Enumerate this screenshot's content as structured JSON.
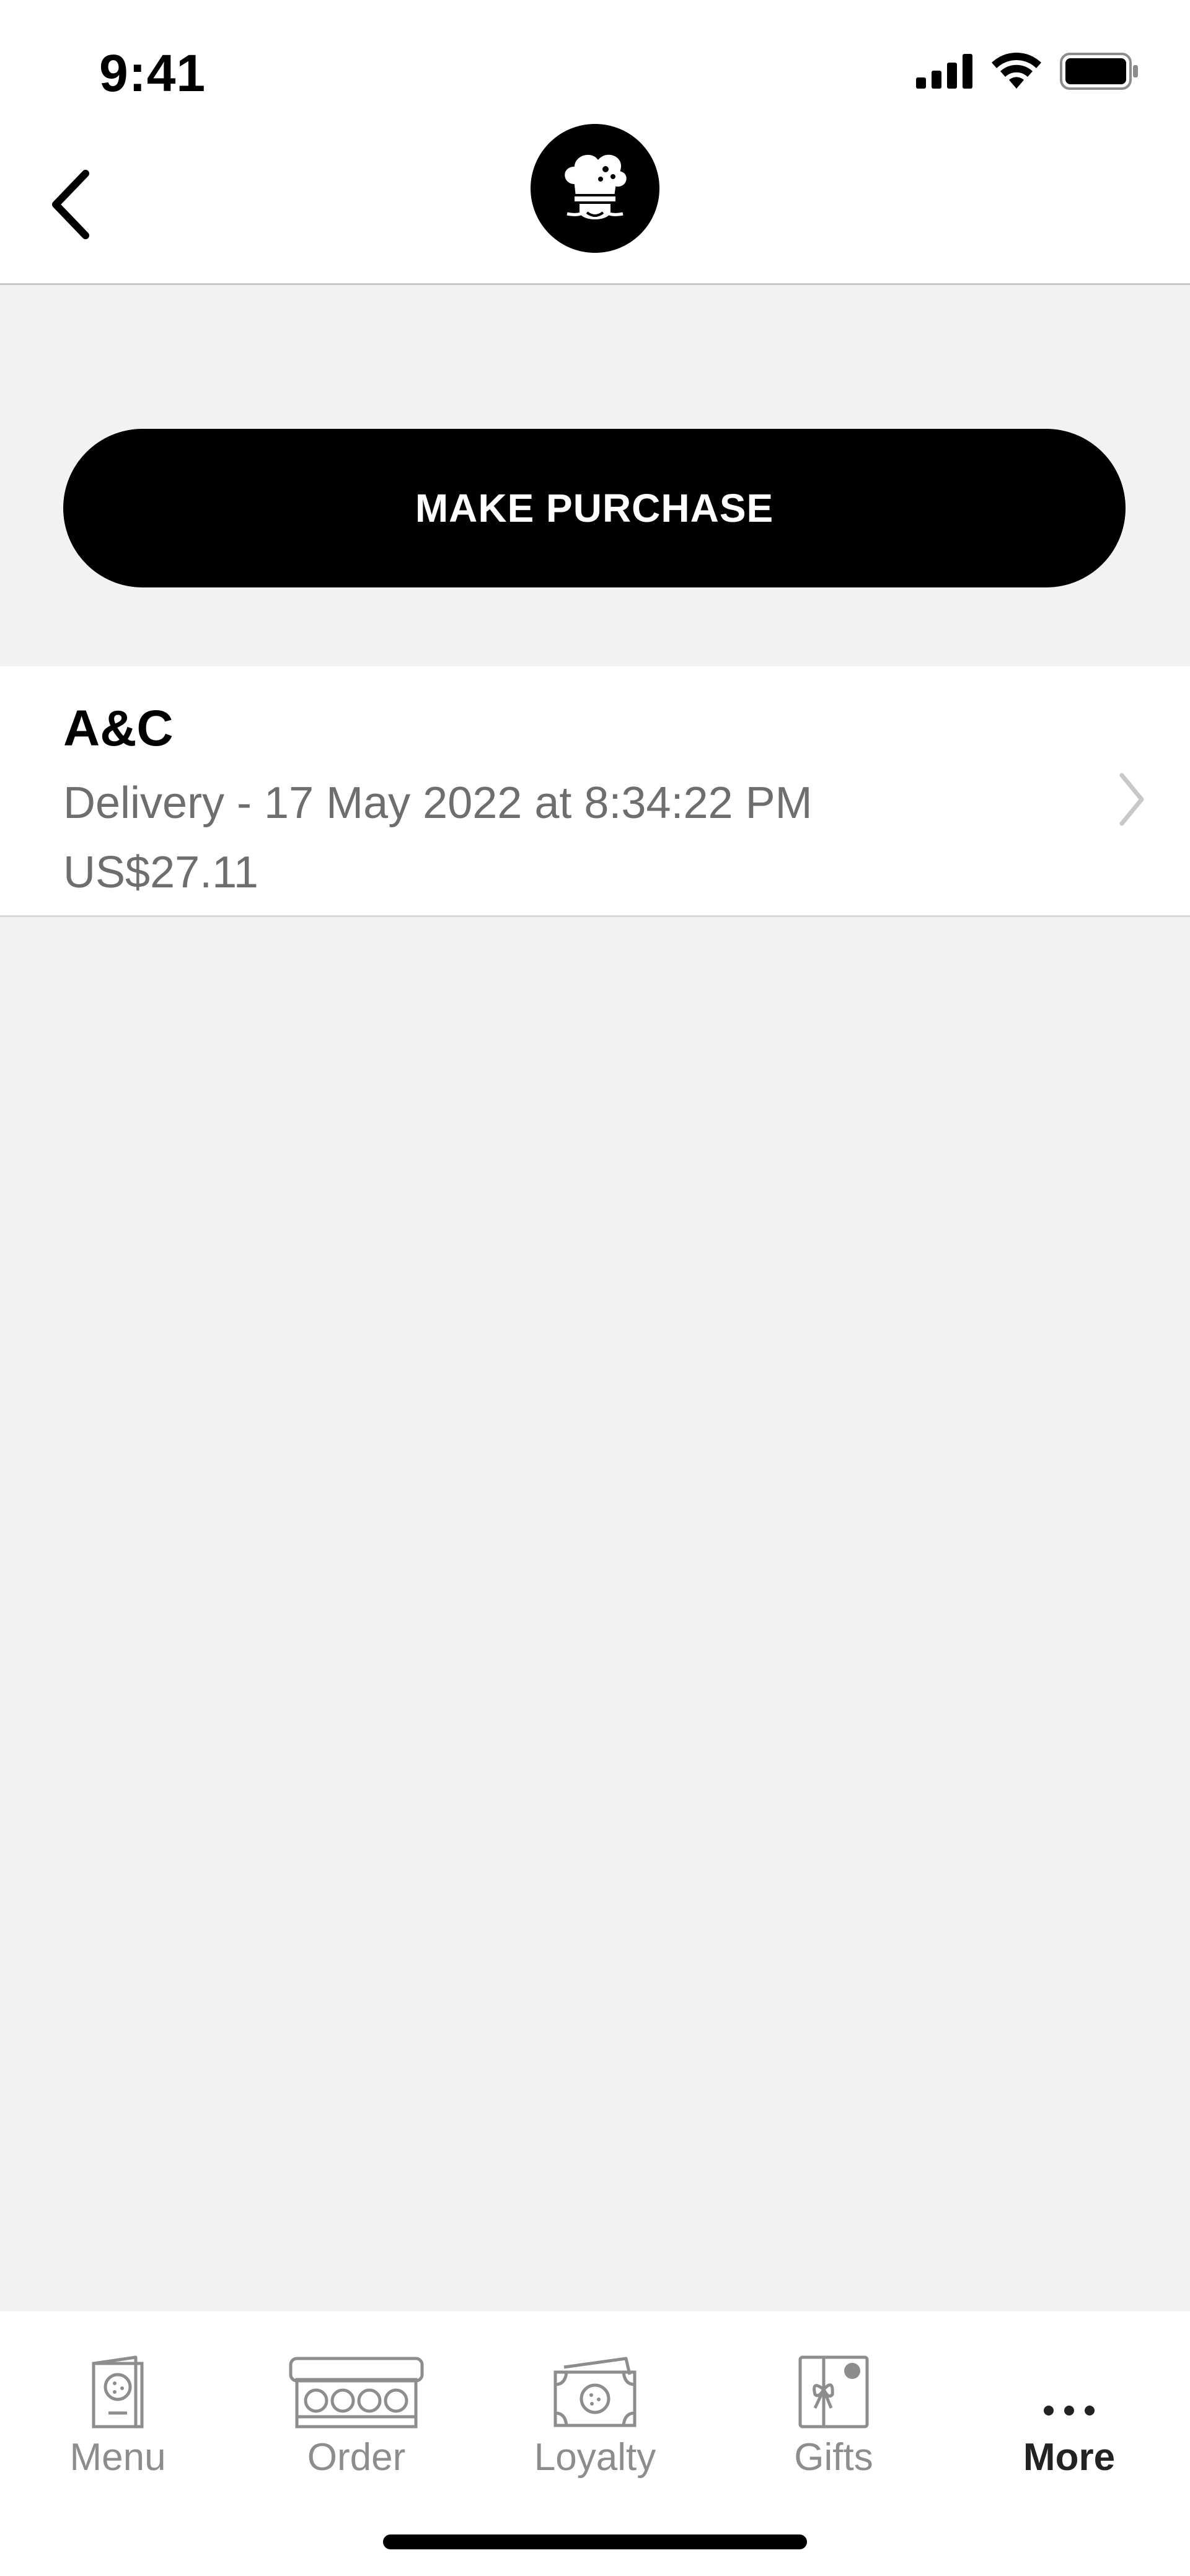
{
  "status_bar": {
    "time": "9:41"
  },
  "header": {
    "logo_icon": "chef-cookie-logo-icon",
    "back_icon": "chevron-left-icon"
  },
  "actions": {
    "make_purchase_label": "MAKE PURCHASE"
  },
  "orders": [
    {
      "name": "A&C",
      "detail": "Delivery - 17 May 2022 at 8:34:22 PM",
      "price": "US$27.11"
    }
  ],
  "tab_bar": {
    "tabs": [
      {
        "label": "Menu",
        "icon": "menu-card-icon",
        "active": false
      },
      {
        "label": "Order",
        "icon": "cookie-box-icon",
        "active": false
      },
      {
        "label": "Loyalty",
        "icon": "loyalty-cash-icon",
        "active": false
      },
      {
        "label": "Gifts",
        "icon": "gift-card-icon",
        "active": false
      },
      {
        "label": "More",
        "icon": "more-dots-icon",
        "active": true
      }
    ]
  },
  "colors": {
    "primary": "#000000",
    "background": "#f2f2f2",
    "muted_text": "#6e6e6e",
    "tab_inactive": "#8d8d8d"
  }
}
